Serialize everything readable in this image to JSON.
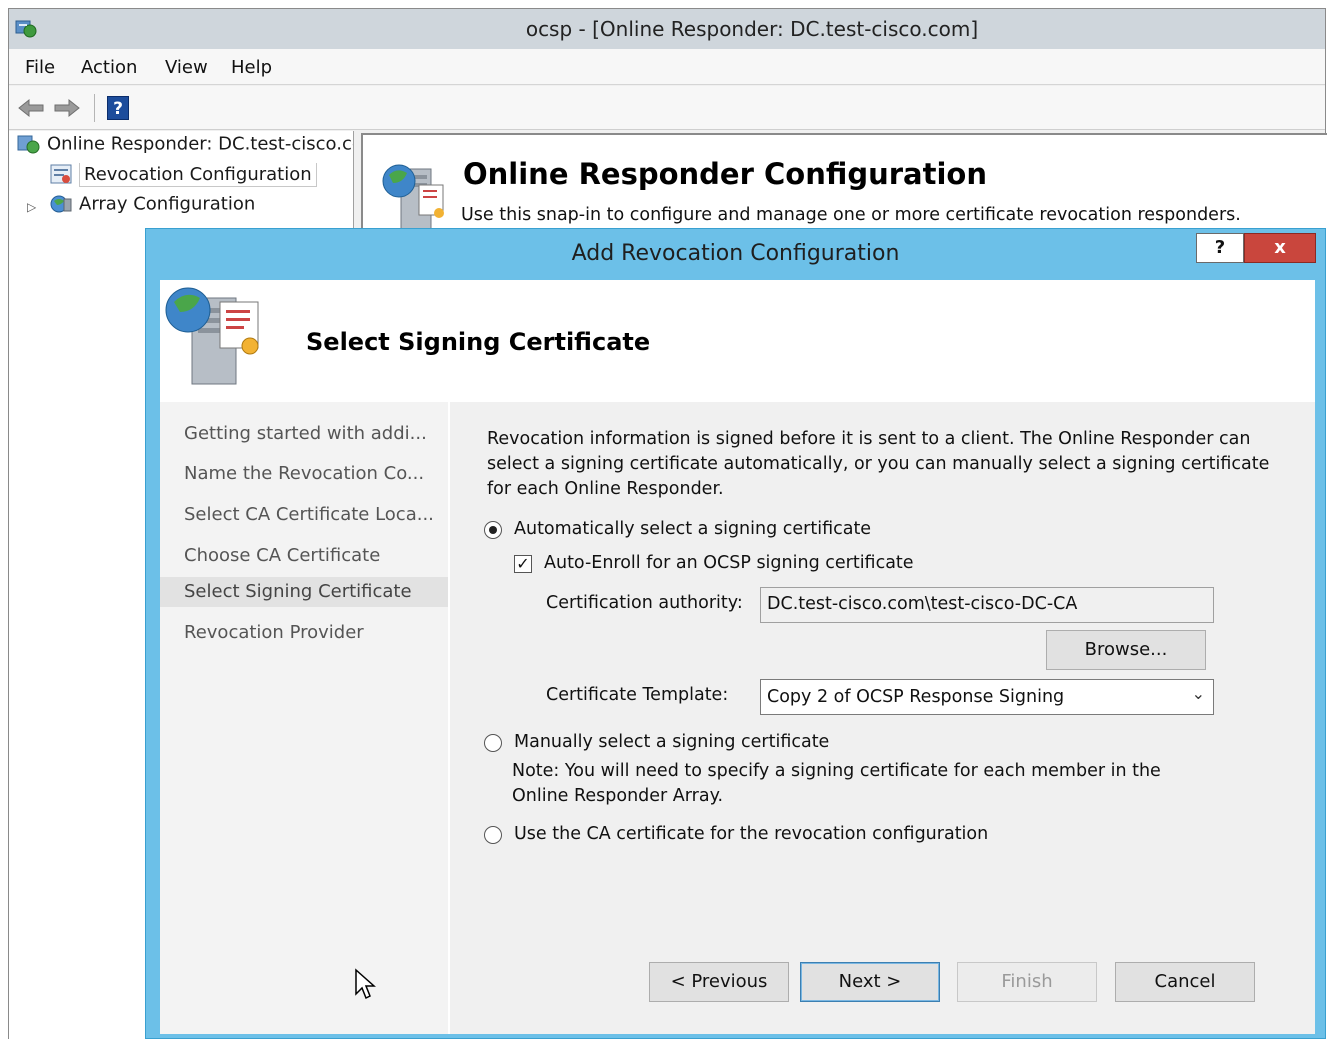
{
  "window": {
    "title": "ocsp - [Online Responder: DC.test-cisco.com]"
  },
  "menu": {
    "items": [
      "File",
      "Action",
      "View",
      "Help"
    ]
  },
  "toolbar": {
    "back_icon": "back-arrow-icon",
    "forward_icon": "forward-arrow-icon",
    "help_icon": "help-book-icon",
    "help_glyph": "?"
  },
  "tree": {
    "root_label": "Online Responder: DC.test-cisco.com",
    "items": [
      {
        "label": "Revocation Configuration",
        "selected": true
      },
      {
        "label": "Array Configuration",
        "selected": false
      }
    ],
    "expander": "▷"
  },
  "result": {
    "title": "Online Responder Configuration",
    "subtitle": "Use this snap-in to configure and manage one or more certificate revocation responders."
  },
  "dialog": {
    "title": "Add Revocation Configuration",
    "help_label": "?",
    "close_label": "x",
    "header_title": "Select Signing Certificate",
    "nav_steps": [
      {
        "label": "Getting started with addi...",
        "current": false
      },
      {
        "label": "Name the Revocation Co...",
        "current": false
      },
      {
        "label": "Select CA Certificate Loca...",
        "current": false
      },
      {
        "label": "Choose CA Certificate",
        "current": false
      },
      {
        "label": "Select Signing Certificate",
        "current": true
      },
      {
        "label": "Revocation Provider",
        "current": false
      }
    ],
    "description": "Revocation information is signed before it is sent to a client. The Online Responder can select a signing certificate automatically, or you can manually select a signing certificate for each Online Responder.",
    "options": {
      "auto_select": {
        "label": "Automatically select a signing certificate",
        "checked": true
      },
      "auto_enroll": {
        "label": "Auto-Enroll for an OCSP signing certificate",
        "checked": true
      },
      "ca_label": "Certification authority:",
      "ca_value": "DC.test-cisco.com\\test-cisco-DC-CA",
      "browse_label": "Browse...",
      "template_label": "Certificate Template:",
      "template_value": "Copy 2 of OCSP Response Signing",
      "manual_select": {
        "label": "Manually select a signing certificate",
        "checked": false
      },
      "manual_note": "Note: You will need to specify a signing certificate for each member in the Online Responder Array.",
      "use_ca_cert": {
        "label": "Use the CA certificate for the revocation configuration",
        "checked": false
      }
    },
    "buttons": {
      "previous": "< Previous",
      "next": "Next >",
      "finish": "Finish",
      "cancel": "Cancel"
    }
  },
  "colors": {
    "dialog_frame": "#6cc0e8",
    "close_button": "#c9463d",
    "title_bar": "#cfd6dc"
  }
}
